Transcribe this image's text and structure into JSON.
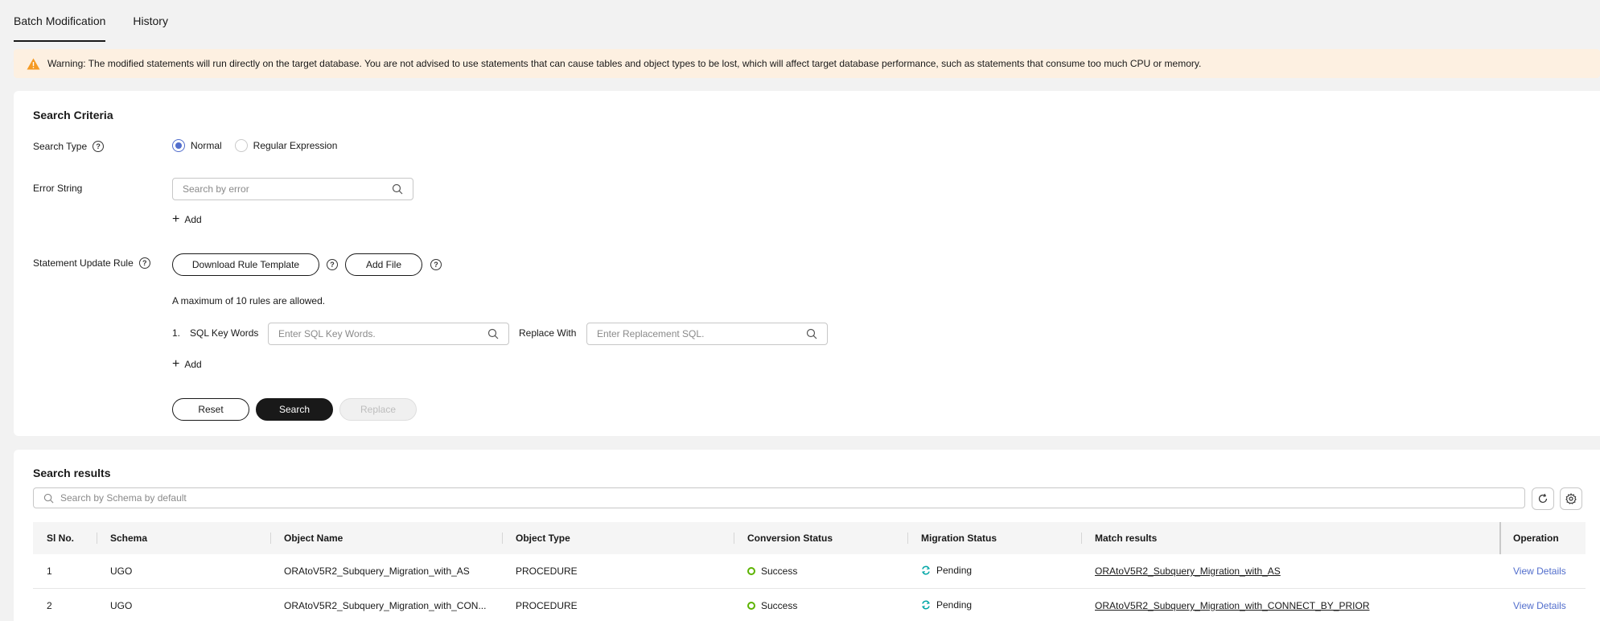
{
  "tabs": [
    {
      "label": "Batch Modification",
      "active": true
    },
    {
      "label": "History",
      "active": false
    }
  ],
  "warning": {
    "text": "Warning: The modified statements will run directly on the target database. You are not advised to use statements that can cause tables and object types to be lost, which will affect target database performance, such as statements that consume too much CPU or memory.",
    "icon": "warning-triangle-icon",
    "color": "#f59a23"
  },
  "criteria": {
    "title": "Search Criteria",
    "search_type_label": "Search Type",
    "search_type_options": [
      "Normal",
      "Regular Expression"
    ],
    "search_type_selected": "Normal",
    "error_string_label": "Error String",
    "error_string_placeholder": "Search by error",
    "add_label": "Add",
    "rule_label": "Statement Update Rule",
    "download_template_label": "Download Rule Template",
    "add_file_label": "Add File",
    "max_rules_note": "A maximum of 10 rules are allowed.",
    "rule_index": "1.",
    "sql_keywords_label": "SQL Key Words",
    "sql_keywords_placeholder": "Enter SQL Key Words.",
    "replace_with_label": "Replace With",
    "replace_placeholder": "Enter Replacement SQL.",
    "add_rule_label": "Add",
    "reset_label": "Reset",
    "search_label": "Search",
    "replace_label": "Replace"
  },
  "results": {
    "title": "Search results",
    "search_placeholder": "Search by Schema by default",
    "columns": [
      "Sl No.",
      "Schema",
      "Object Name",
      "Object Type",
      "Conversion Status",
      "Migration Status",
      "Match results",
      "Operation"
    ],
    "rows": [
      {
        "no": "1",
        "schema": "UGO",
        "object_name": "ORAtoV5R2_Subquery_Migration_with_AS",
        "object_type": "PROCEDURE",
        "conversion": "Success",
        "migration": "Pending",
        "match": "ORAtoV5R2_Subquery_Migration_with_AS",
        "operation": "View Details"
      },
      {
        "no": "2",
        "schema": "UGO",
        "object_name": "ORAtoV5R2_Subquery_Migration_with_CON...",
        "object_type": "PROCEDURE",
        "conversion": "Success",
        "migration": "Pending",
        "match": "ORAtoV5R2_Subquery_Migration_with_CONNECT_BY_PRIOR",
        "operation": "View Details"
      }
    ]
  },
  "colors": {
    "accent": "#526ecc",
    "success": "#5cb300",
    "pending": "#00a6a6",
    "warning_bg": "#fdf0e1"
  }
}
